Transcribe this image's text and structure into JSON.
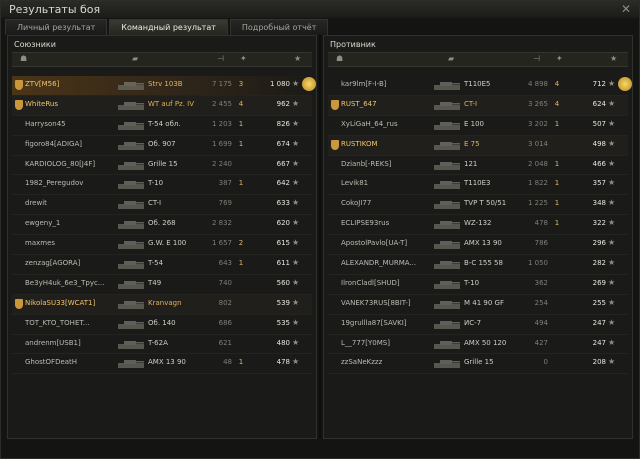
{
  "window": {
    "title": "Результаты боя",
    "close_label": "✕"
  },
  "tabs": [
    {
      "label": "Личный результат",
      "active": false
    },
    {
      "label": "Командный результат",
      "active": true
    },
    {
      "label": "Подробный отчёт",
      "active": false
    }
  ],
  "headers": {
    "player_icon": "player-icon",
    "tank_icon": "tank-icon",
    "damage_icon": "damage-icon",
    "kills_icon": "kills-icon",
    "xp_icon": "xp-icon"
  },
  "allies": {
    "title": "Союзники",
    "rows": [
      {
        "name": "ZTV[M56]",
        "tank": "Strv 103B",
        "damage": "7 175",
        "kills": "3",
        "xp": "1 080",
        "self": true,
        "badge": true,
        "medal": true
      },
      {
        "name": "WhiteRus",
        "tank": "WT auf Pz. IV",
        "damage": "2 455",
        "kills": "4",
        "xp": "962",
        "platoon": true,
        "badge": true
      },
      {
        "name": "Harryson45",
        "tank": "T-54 обл.",
        "damage": "1 203",
        "kills": "1",
        "xp": "826"
      },
      {
        "name": "figoro84[ADIGA]",
        "tank": "Об. 907",
        "damage": "1 699",
        "kills": "1",
        "xp": "674"
      },
      {
        "name": "KARDIOLOG_80[J4F]",
        "tank": "Grille 15",
        "damage": "2 240",
        "kills": "",
        "xp": "667"
      },
      {
        "name": "1982_Peregudov",
        "tank": "T-10",
        "damage": "387",
        "kills": "1",
        "xp": "642"
      },
      {
        "name": "drewit",
        "tank": "CT-I",
        "damage": "769",
        "kills": "",
        "xp": "633"
      },
      {
        "name": "ewgeny_1",
        "tank": "Об. 268",
        "damage": "2 832",
        "kills": "",
        "xp": "620"
      },
      {
        "name": "maxmes",
        "tank": "G.W. E 100",
        "damage": "1 657",
        "kills": "2",
        "xp": "615"
      },
      {
        "name": "zenzag[AGORA]",
        "tank": "T-54",
        "damage": "643",
        "kills": "1",
        "xp": "611"
      },
      {
        "name": "Be3yH4uk_6e3_Tpyc...",
        "tank": "T49",
        "damage": "740",
        "kills": "",
        "xp": "560"
      },
      {
        "name": "NikolaSU33[WCAT1]",
        "tank": "Kranvagn",
        "damage": "802",
        "kills": "",
        "xp": "539",
        "platoon": true,
        "badge": true
      },
      {
        "name": "TOT_KTO_TOHET...",
        "tank": "Об. 140",
        "damage": "686",
        "kills": "",
        "xp": "535"
      },
      {
        "name": "andrenm[USB1]",
        "tank": "T-62A",
        "damage": "621",
        "kills": "",
        "xp": "480"
      },
      {
        "name": "GhostOFDeatH",
        "tank": "AMX 13 90",
        "damage": "48",
        "kills": "1",
        "xp": "478"
      }
    ]
  },
  "enemies": {
    "title": "Противник",
    "rows": [
      {
        "name": "kar9lm[F-I-B]",
        "tank": "T110E5",
        "damage": "4 898",
        "kills": "4",
        "xp": "712",
        "medal": true
      },
      {
        "name": "RUST_647",
        "tank": "CT-I",
        "damage": "3 265",
        "kills": "4",
        "xp": "624",
        "platoon": true,
        "badge": true
      },
      {
        "name": "XyLiGaH_64_rus",
        "tank": "E 100",
        "damage": "3 202",
        "kills": "1",
        "xp": "507"
      },
      {
        "name": "RUSTIKOM",
        "tank": "E 75",
        "damage": "3 014",
        "kills": "",
        "xp": "498",
        "platoon": true,
        "badge": true
      },
      {
        "name": "Dzianb[-REKS]",
        "tank": "121",
        "damage": "2 048",
        "kills": "1",
        "xp": "466"
      },
      {
        "name": "Levik81",
        "tank": "T110E3",
        "damage": "1 822",
        "kills": "1",
        "xp": "357"
      },
      {
        "name": "CokoJI77",
        "tank": "TVP T 50/51",
        "damage": "1 225",
        "kills": "1",
        "xp": "348"
      },
      {
        "name": "ECLIPSE93rus",
        "tank": "WZ-132",
        "damage": "478",
        "kills": "1",
        "xp": "322"
      },
      {
        "name": "ApostolPavlo[UA-T]",
        "tank": "AMX 13 90",
        "damage": "786",
        "kills": "",
        "xp": "296"
      },
      {
        "name": "ALEXANDR_MURMA...",
        "tank": "B-C 155 58",
        "damage": "1 050",
        "kills": "",
        "xp": "282"
      },
      {
        "name": "IlronCladl[SHUD]",
        "tank": "T-10",
        "damage": "362",
        "kills": "",
        "xp": "269"
      },
      {
        "name": "VANEK73RUS[8BIT-]",
        "tank": "M 41 90 GF",
        "damage": "254",
        "kills": "",
        "xp": "255"
      },
      {
        "name": "19grullla87[SAVKI]",
        "tank": "ИС-7",
        "damage": "494",
        "kills": "",
        "xp": "247"
      },
      {
        "name": "L__777[Y0MS]",
        "tank": "AMX 50 120",
        "damage": "427",
        "kills": "",
        "xp": "247"
      },
      {
        "name": "zzSaNeKzzz",
        "tank": "Grille 15",
        "damage": "0",
        "kills": "",
        "xp": "208"
      }
    ]
  }
}
